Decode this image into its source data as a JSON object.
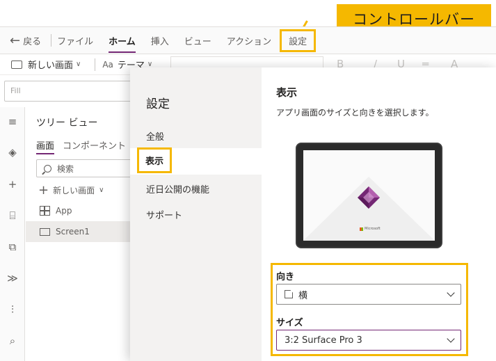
{
  "callout": {
    "label": "コントロールバー"
  },
  "menubar": {
    "back_label": "戻る",
    "items": [
      "ファイル",
      "ホーム",
      "挿入",
      "ビュー",
      "アクション",
      "設定"
    ],
    "active_index": 1
  },
  "toolbar": {
    "new_screen_label": "新しい画面",
    "theme_icon": "Aa",
    "theme_label": "テーマ",
    "format_glyphs": [
      "B",
      "/",
      "U",
      "═",
      "A"
    ]
  },
  "formula": {
    "value": "Fill"
  },
  "tree": {
    "title": "ツリー ビュー",
    "tabs": [
      "画面",
      "コンポーネント"
    ],
    "search_placeholder": "検索",
    "new_screen_label": "新しい画面",
    "rows": [
      {
        "label": "App",
        "icon": "app-grid-icon"
      },
      {
        "label": "Screen1",
        "icon": "screen-icon",
        "selected": true
      }
    ]
  },
  "rail_icons": [
    "hamburger-icon",
    "layers-icon",
    "plus-icon",
    "database-icon",
    "media-icon",
    "flow-icon",
    "tools-icon",
    "search-icon"
  ],
  "dialog": {
    "title": "設定",
    "nav": [
      "全般",
      "表示",
      "近日公開の機能",
      "サポート"
    ],
    "active_nav": 1,
    "content_title": "表示",
    "content_desc": "アプリ画面のサイズと向きを選択します。",
    "preview_brand": "Microsoft",
    "orientation_label": "向き",
    "orientation_value": "横",
    "size_label": "サイズ",
    "size_value": "3:2 Surface Pro 3"
  },
  "colors": {
    "accent": "#742774",
    "highlight": "#f5b800"
  }
}
